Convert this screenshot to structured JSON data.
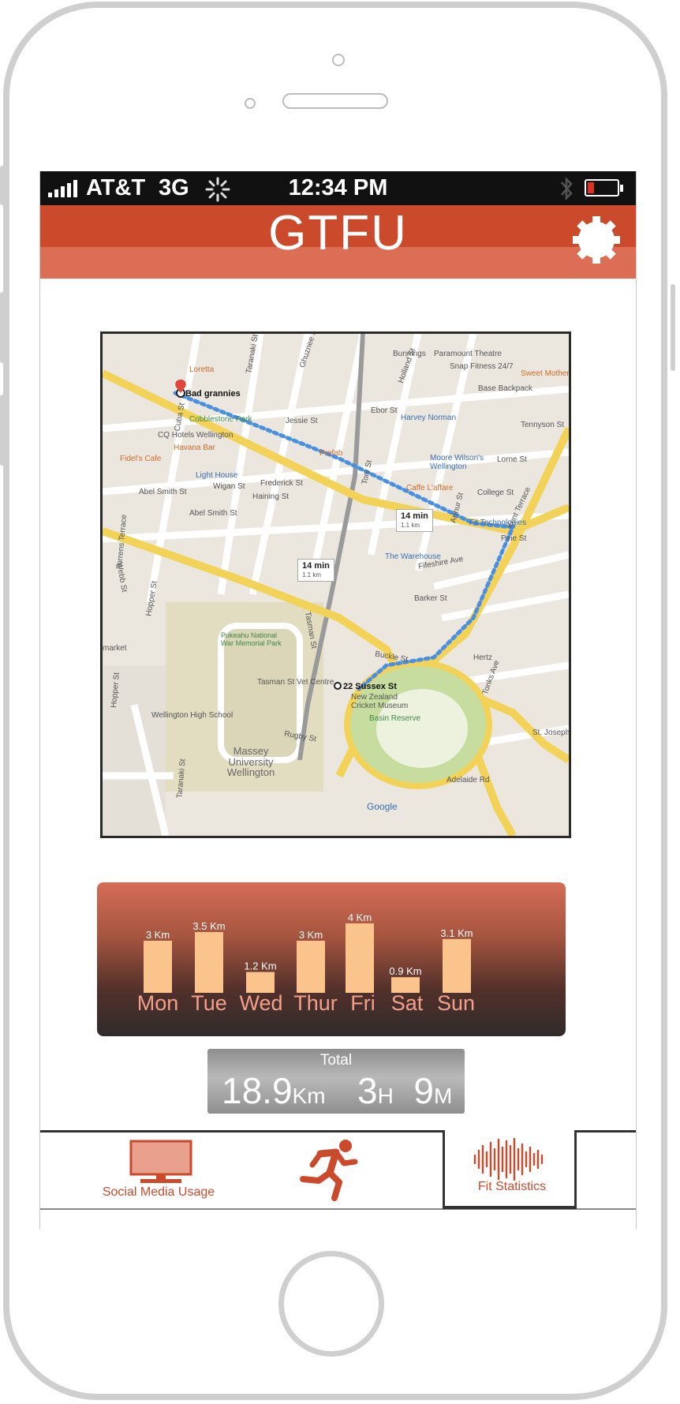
{
  "status_bar": {
    "carrier": "AT&T",
    "network": "3G",
    "time": "12:34 PM",
    "icons": [
      "signal-icon",
      "loading-spinner-icon",
      "bluetooth-icon",
      "battery-low-icon"
    ]
  },
  "header": {
    "title": "GTFU",
    "settings_icon": "gear-icon"
  },
  "map": {
    "start_label": "Bad grannies",
    "end_label": "22 Sussex St",
    "route_time_1": "14 min",
    "route_distance_1": "1.1 km",
    "route_time_2": "14 min",
    "route_distance_2": "1.1 km",
    "places": {
      "loretta": "Loretta",
      "cobblestone_park": "Cobblestone Park",
      "cq_hotels": "CQ Hotels Wellington",
      "havana_bar": "Havana Bar",
      "fidels_cafe": "Fidel's Cafe",
      "light_house": "Light House",
      "prefab": "Prefab",
      "harvey_norman": "Harvey Norman",
      "moore_wilsons": "Moore Wilson's Wellington",
      "caffe_laffare": "Caffe L'affare",
      "bunnings": "Bunnings",
      "paramount_theatre": "Paramount Theatre",
      "snap_fitness": "Snap Fitness 24/7",
      "sweet_mother": "Sweet Mother",
      "base_backpackers": "Base Backpack",
      "the_warehouse": "The Warehouse",
      "fit_technologies": "Fit Technologies",
      "pukeahu": "Pukeahu National War Memorial Park",
      "tasman_vet": "Tasman St Vet Centre",
      "nz_cricket_museum": "New Zealand Cricket Museum",
      "basin_reserve": "Basin Reserve",
      "wellington_high_school": "Wellington High School",
      "massey": "Massey University Wellington",
      "hertz": "Hertz",
      "st_joseph": "St. Joseph",
      "market": "market",
      "google": "Google"
    },
    "streets": {
      "ghuznee": "Ghuznee St",
      "cuba": "Cuba St",
      "taranaki": "Taranaki St",
      "jessie": "Jessie St",
      "ebor": "Ebor St",
      "tennyson": "Tennyson St",
      "lorne": "Lorne St",
      "college": "College St",
      "frederick": "Frederick St",
      "haining": "Haining St",
      "wigan": "Wigan St",
      "abel_smith_1": "Abel Smith St",
      "abel_smith_2": "Abel Smith St",
      "webb": "Webb St",
      "hopper": "Hopper St",
      "kent_terrace": "Kent Terrace",
      "pirie": "Pirie St",
      "barker": "Barker St",
      "buckle": "Buckle St",
      "tasman": "Tasman St",
      "rugby": "Rugby St",
      "holland": "Holland St",
      "tory": "Tory St",
      "arthur": "Arthur St",
      "tonks": "Tonks Ave",
      "feltex": "Fifeshire Ave",
      "torrens_terrace": "Torrens Terrace",
      "hopper_2": "Hopper St",
      "taranaki_2": "Taranaki St",
      "adelaide": "Adelaide Rd"
    }
  },
  "chart_data": {
    "type": "bar",
    "title": "",
    "xlabel": "",
    "ylabel": "",
    "categories": [
      "Mon",
      "Tue",
      "Wed",
      "Thur",
      "Fri",
      "Sat",
      "Sun"
    ],
    "values": [
      3,
      3.5,
      1.2,
      3,
      4,
      0.9,
      3.1
    ],
    "value_labels": [
      "3 Km",
      "3.5 Km",
      "1.2 Km",
      "3 Km",
      "4 Km",
      "0.9 Km",
      "3.1 Km"
    ],
    "ylim": [
      0,
      4
    ],
    "grid": false,
    "bar_color": "#fcc48d",
    "label_color": "#f2a08a"
  },
  "total": {
    "label": "Total",
    "distance_value": "18.9",
    "distance_unit": "Km",
    "hours_value": "3",
    "hours_unit": "H",
    "minutes_value": "9",
    "minutes_unit": "M"
  },
  "tabs": {
    "social_label": "Social Media Usage",
    "social_icon": "monitor-icon",
    "run_icon": "running-man-icon",
    "fit_label": "Fit Statistics",
    "fit_icon": "sound-wave-icon",
    "selected": "Fit Statistics"
  },
  "colors": {
    "accent": "#cc4a2c",
    "header_light": "#dc6e55",
    "route": "#4a90e2"
  }
}
